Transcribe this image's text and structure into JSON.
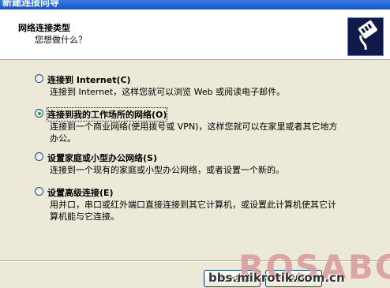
{
  "window": {
    "title": "新建连接向导"
  },
  "header": {
    "title": "网络连接类型",
    "subtitle": "您想做什么？",
    "icon": "network-cable-icon"
  },
  "options": [
    {
      "label": "连接到 Internet(C)",
      "description": "连接到 Internet，这样您就可以浏览 Web 或阅读电子邮件。",
      "selected": false
    },
    {
      "label": "连接到我的工作场所的网络(O)",
      "description": "连接到一个商业网络(使用拨号或 VPN)，这样您就可以在家里或者其它地方办公。",
      "selected": true
    },
    {
      "label": "设置家庭或小型办公网络(S)",
      "description": "连接到一个现有的家庭或小型办公网络，或者设置一个新的。",
      "selected": false
    },
    {
      "label": "设置高级连接(E)",
      "description": "用并口，串口或红外端口直接连接到其它计算机，或设置此计算机使其它计算机能与它连接。",
      "selected": false
    }
  ],
  "buttons": {
    "back": "< 上一步(B)",
    "next": "下一步(N) >"
  },
  "watermark": {
    "brand": "ROSABC",
    "url": "bbs.mikrotik.com.cn"
  }
}
